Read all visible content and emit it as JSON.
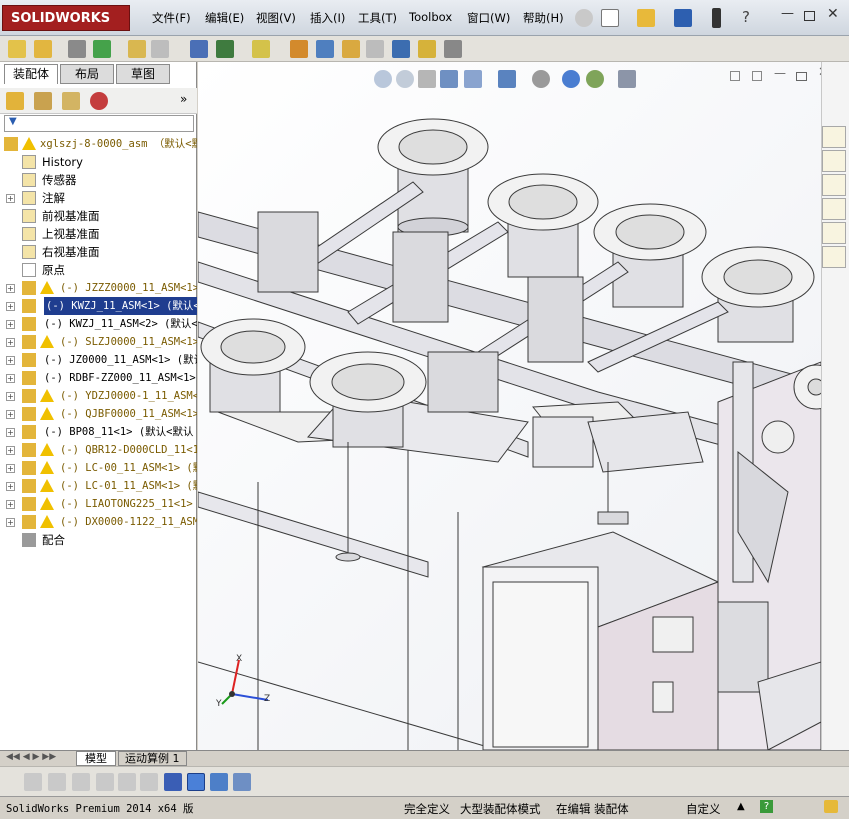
{
  "app": {
    "logo_text": "SOLIDWORKS",
    "brand_color": "#a31f1f"
  },
  "menu": [
    "文件(F)",
    "编辑(E)",
    "视图(V)",
    "插入(I)",
    "工具(T)",
    "Toolbox",
    "窗口(W)",
    "帮助(H)"
  ],
  "panel_tabs": [
    "装配体",
    "布局",
    "草图"
  ],
  "tree": {
    "root": "xglszj-8-0000_asm （默认<默",
    "items": [
      {
        "label": "History"
      },
      {
        "label": "传感器"
      },
      {
        "label": "注解"
      },
      {
        "label": "前视基准面"
      },
      {
        "label": "上视基准面"
      },
      {
        "label": "右视基准面"
      },
      {
        "label": "原点"
      },
      {
        "label": "(-) JZZZ0000_11_ASM<1>"
      },
      {
        "label": "(-) KWZJ_11_ASM<1> (默认<"
      },
      {
        "label": "(-) KWZJ_11_ASM<2> (默认<"
      },
      {
        "label": "(-) SLZJ0000_11_ASM<1>"
      },
      {
        "label": "(-) JZ0000_11_ASM<1> (默认"
      },
      {
        "label": "(-) RDBF-ZZ000_11_ASM<1>"
      },
      {
        "label": "(-) YDZJ0000-1_11_ASM<1"
      },
      {
        "label": "(-) QJBF0000_11_ASM<1>"
      },
      {
        "label": "(-) BP08_11<1> (默认<默认"
      },
      {
        "label": "(-) QBR12-D000CLD_11<1>"
      },
      {
        "label": "(-) LC-00_11_ASM<1> (默"
      },
      {
        "label": "(-) LC-01_11_ASM<1> (默"
      },
      {
        "label": "(-) LIAOTONG225_11<1>"
      },
      {
        "label": "(-) DX0000-1122_11_ASM<"
      },
      {
        "label": "配合"
      }
    ]
  },
  "bottom_tabs": [
    "模型",
    "运动算例 1"
  ],
  "axis_labels": {
    "x": "Z",
    "y": "X",
    "z": "Y"
  },
  "status": {
    "app_version": "SolidWorks Premium 2014 x64 版",
    "definition": "完全定义",
    "mode": "大型装配体模式",
    "editing": "在编辑 装配体",
    "custom": "自定义"
  }
}
